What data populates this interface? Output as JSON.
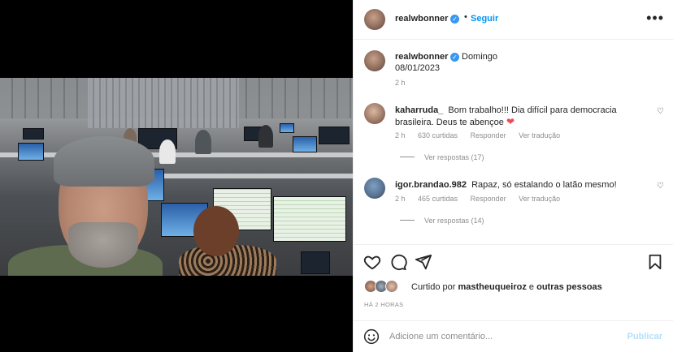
{
  "post": {
    "username": "realwbonner",
    "verified": true,
    "follow_label": "Seguir",
    "dot": "•",
    "more_icon": "more-horizontal-icon"
  },
  "caption": {
    "username": "realwbonner",
    "text": "Domingo",
    "date": "08/01/2023",
    "ago": "2 h"
  },
  "comments": [
    {
      "username": "kaharruda_",
      "text": "Bom trabalho!!! Dia difícil para democracia brasileira. Deus te abençoe",
      "emoji": "❤",
      "time": "2 h",
      "likes": "630 curtidas",
      "reply": "Responder",
      "translate": "Ver tradução",
      "view_replies": "Ver respostas (17)"
    },
    {
      "username": "igor.brandao.982",
      "text": "Rapaz, só estalando o latão mesmo!",
      "time": "2 h",
      "likes": "465 curtidas",
      "reply": "Responder",
      "translate": "Ver tradução",
      "view_replies": "Ver respostas (14)"
    }
  ],
  "liked_by": {
    "prefix": "Curtido por",
    "user": "mastheuqueiroz",
    "joiner": "e",
    "others": "outras pessoas"
  },
  "post_time": "HÁ 2 HORAS",
  "add_comment": {
    "placeholder": "Adicione um comentário...",
    "publish_label": "Publicar"
  },
  "colors": {
    "accent": "#0095f6",
    "verified": "#3897f0",
    "publish_disabled": "#b2dffc",
    "secondary_text": "#8e8e8e"
  }
}
